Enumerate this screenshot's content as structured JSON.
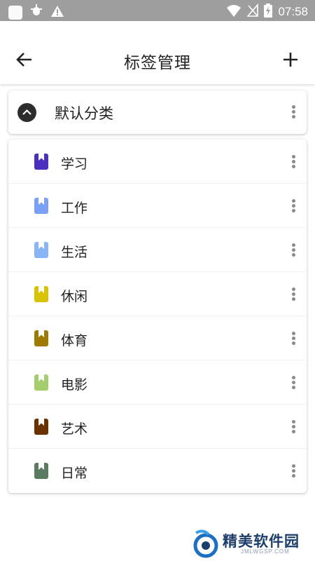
{
  "status_bar": {
    "time": "07:58",
    "icons": [
      "app-square-icon",
      "bug-icon",
      "warning-icon",
      "wifi-icon",
      "no-signal-icon",
      "battery-charging-icon"
    ]
  },
  "app_bar": {
    "title": "标签管理",
    "back_icon": "arrow-left-icon",
    "add_icon": "plus-icon"
  },
  "group": {
    "title": "默认分类",
    "expanded": true,
    "toggle_icon": "chevron-up-icon"
  },
  "tags": [
    {
      "label": "学习",
      "color": "#4a2fc0"
    },
    {
      "label": "工作",
      "color": "#7a9ff7"
    },
    {
      "label": "生活",
      "color": "#8ab4f8"
    },
    {
      "label": "休闲",
      "color": "#d9c300"
    },
    {
      "label": "体育",
      "color": "#9e7b00"
    },
    {
      "label": "电影",
      "color": "#a4cd6d"
    },
    {
      "label": "艺术",
      "color": "#6b3200"
    },
    {
      "label": "日常",
      "color": "#5a7a62"
    }
  ],
  "watermark": {
    "text": "精美软件园",
    "sub": "JMLWGSP.COM"
  }
}
